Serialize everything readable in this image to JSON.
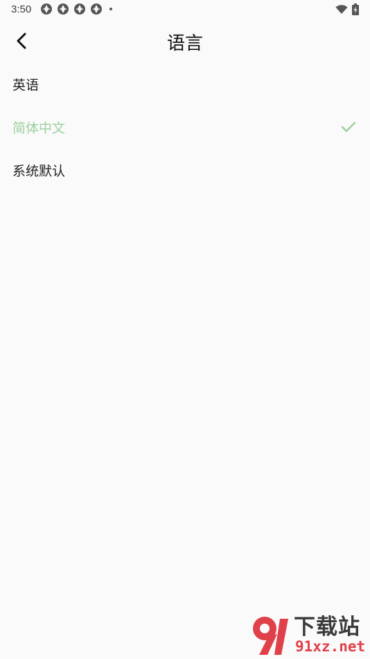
{
  "status_bar": {
    "time": "3:50",
    "notification_icons": [
      "app-notification-icon",
      "app-notification-icon",
      "app-notification-icon",
      "app-notification-icon"
    ],
    "system_icons": [
      "wifi-icon",
      "battery-charging-icon"
    ]
  },
  "toolbar": {
    "back_icon": "chevron-left-icon",
    "title": "语言"
  },
  "languages": [
    {
      "label": "英语",
      "selected": false
    },
    {
      "label": "简体中文",
      "selected": true
    },
    {
      "label": "系统默认",
      "selected": false
    }
  ],
  "colors": {
    "background": "#fafafa",
    "selected_text": "#9bd09e",
    "text": "#212121"
  },
  "watermark": {
    "title": "下载站",
    "domain": "91xz.net"
  }
}
